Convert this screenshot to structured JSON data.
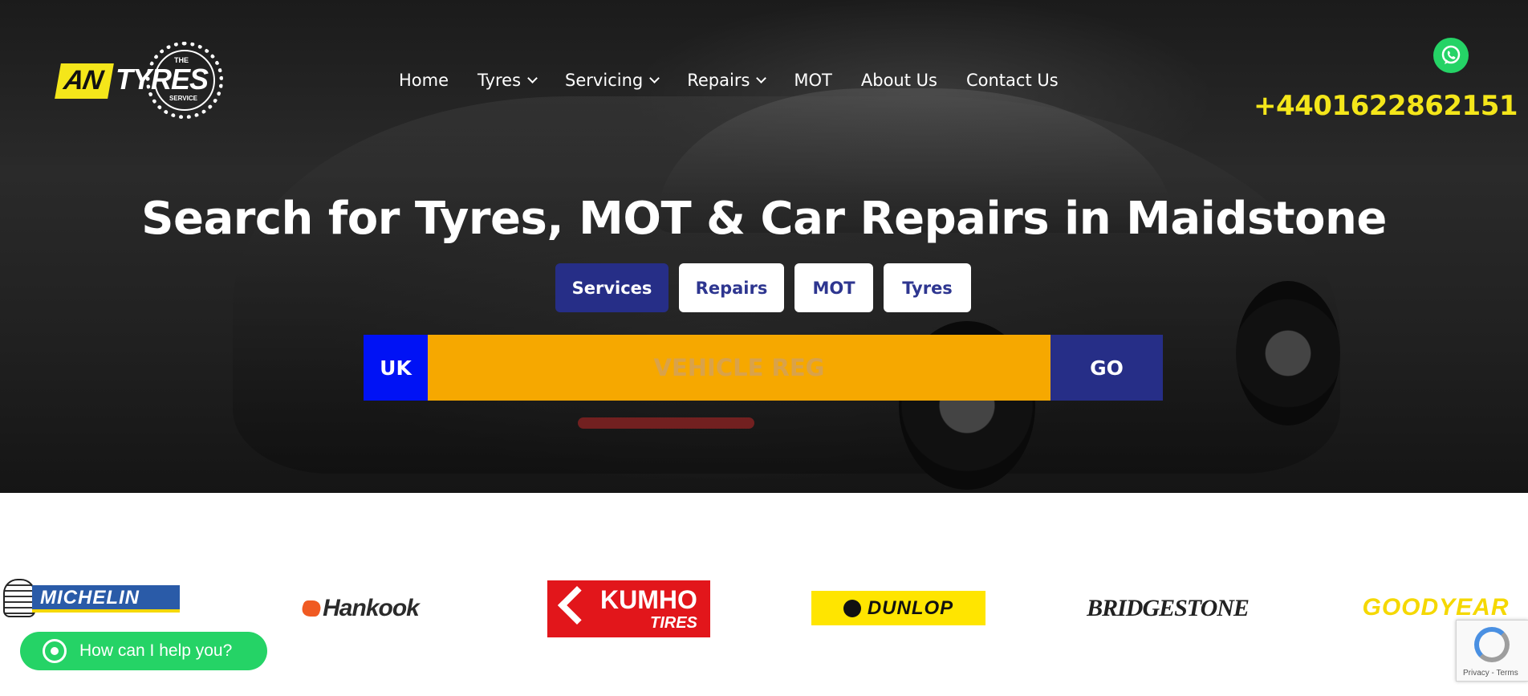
{
  "brand": {
    "logo_an": "AN",
    "logo_tyres": "TYRES",
    "logo_the": "THE",
    "logo_service": "SERVICE"
  },
  "nav": {
    "items": [
      {
        "label": "Home",
        "dropdown": false
      },
      {
        "label": "Tyres",
        "dropdown": true
      },
      {
        "label": "Servicing",
        "dropdown": true
      },
      {
        "label": "Repairs",
        "dropdown": true
      },
      {
        "label": "MOT",
        "dropdown": false
      },
      {
        "label": "About Us",
        "dropdown": false
      },
      {
        "label": "Contact Us",
        "dropdown": false
      }
    ]
  },
  "contact": {
    "phone": "+4401622862151",
    "whatsapp_icon": "whatsapp-icon"
  },
  "hero": {
    "headline": "Search for Tyres, MOT & Car Repairs in Maidstone",
    "tabs": [
      {
        "label": "Services",
        "active": true
      },
      {
        "label": "Repairs",
        "active": false
      },
      {
        "label": "MOT",
        "active": false
      },
      {
        "label": "Tyres",
        "active": false
      }
    ],
    "search": {
      "country": "UK",
      "placeholder": "VEHICLE REG",
      "value": "",
      "go_label": "GO"
    }
  },
  "brands": {
    "logos": [
      {
        "name": "MICHELIN",
        "color": "#2a5ba8"
      },
      {
        "name": "Hankook",
        "color": "#f05a22"
      },
      {
        "name": "KUMHO",
        "sub": "TIRES",
        "color": "#e2161b"
      },
      {
        "name": "DUNLOP",
        "color": "#ffe500"
      },
      {
        "name": "BRIDGESTONE",
        "color": "#222222"
      },
      {
        "name": "GOODYEAR",
        "color": "#f5d800"
      }
    ]
  },
  "chat": {
    "label": "How can I help you?"
  },
  "recaptcha": {
    "text": "Privacy - Terms"
  },
  "colors": {
    "accent_yellow": "#f4e61a",
    "primary_navy": "#262e87",
    "reg_orange": "#f6a800",
    "uk_blue": "#0012f5",
    "whatsapp_green": "#25d366"
  }
}
